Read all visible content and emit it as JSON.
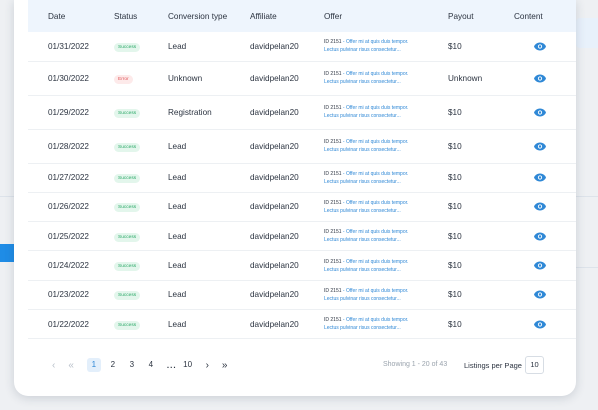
{
  "columns": [
    "Date",
    "Status",
    "Conversion type",
    "Affiliate",
    "Offer",
    "Payout",
    "Content"
  ],
  "rows": [
    {
      "date": "01/31/2022",
      "status": "Success",
      "status_kind": "success",
      "conversion": "Lead",
      "affiliate": "davidpelan20",
      "offer_id": "ID 2151",
      "offer_text": "- Offer mi at quis duis tempor.",
      "offer_line2": "Lectus pulvinar risus consectetur...",
      "payout": "$10"
    },
    {
      "date": "01/30/2022",
      "status": "Error",
      "status_kind": "error",
      "conversion": "Unknown",
      "affiliate": "davidpelan20",
      "offer_id": "ID 2151",
      "offer_text": "- Offer mi at quis duis tempor.",
      "offer_line2": "Lectus pulvinar risus consectetur...",
      "payout": "Unknown"
    },
    {
      "date": "01/29/2022",
      "status": "Success",
      "status_kind": "success",
      "conversion": "Registration",
      "affiliate": "davidpelan20",
      "offer_id": "ID 2151",
      "offer_text": "- Offer mi at quis duis tempor.",
      "offer_line2": "Lectus pulvinar risus consectetur...",
      "payout": "$10"
    },
    {
      "date": "01/28/2022",
      "status": "Success",
      "status_kind": "success",
      "conversion": "Lead",
      "affiliate": "davidpelan20",
      "offer_id": "ID 2151",
      "offer_text": "- Offer mi at quis duis tempor.",
      "offer_line2": "Lectus pulvinar risus consectetur...",
      "payout": "$10"
    },
    {
      "date": "01/27/2022",
      "status": "Success",
      "status_kind": "success",
      "conversion": "Lead",
      "affiliate": "davidpelan20",
      "offer_id": "ID 2151",
      "offer_text": "- Offer mi at quis duis tempor.",
      "offer_line2": "Lectus pulvinar risus consectetur...",
      "payout": "$10"
    },
    {
      "date": "01/26/2022",
      "status": "Success",
      "status_kind": "success",
      "conversion": "Lead",
      "affiliate": "davidpelan20",
      "offer_id": "ID 2151",
      "offer_text": "- Offer mi at quis duis tempor.",
      "offer_line2": "Lectus pulvinar risus consectetur...",
      "payout": "$10"
    },
    {
      "date": "01/25/2022",
      "status": "Success",
      "status_kind": "success",
      "conversion": "Lead",
      "affiliate": "davidpelan20",
      "offer_id": "ID 2151",
      "offer_text": "- Offer mi at quis duis tempor.",
      "offer_line2": "Lectus pulvinar risus consectetur...",
      "payout": "$10"
    },
    {
      "date": "01/24/2022",
      "status": "Success",
      "status_kind": "success",
      "conversion": "Lead",
      "affiliate": "davidpelan20",
      "offer_id": "ID 2151",
      "offer_text": "- Offer mi at quis duis tempor.",
      "offer_line2": "Lectus pulvinar risus consectetur...",
      "payout": "$10"
    },
    {
      "date": "01/23/2022",
      "status": "Success",
      "status_kind": "success",
      "conversion": "Lead",
      "affiliate": "davidpelan20",
      "offer_id": "ID 2151",
      "offer_text": "- Offer mi at quis duis tempor.",
      "offer_line2": "Lectus pulvinar risus consectetur...",
      "payout": "$10"
    },
    {
      "date": "01/22/2022",
      "status": "Success",
      "status_kind": "success",
      "conversion": "Lead",
      "affiliate": "davidpelan20",
      "offer_id": "ID 2151",
      "offer_text": "- Offer mi at quis duis tempor.",
      "offer_line2": "Lectus pulvinar risus consectetur...",
      "payout": "$10"
    }
  ],
  "content_icon": "eye-icon",
  "colors": {
    "accent": "#2f88d6",
    "success": "#28a765",
    "error": "#e0565a",
    "header_bg": "#eef5fd"
  },
  "pagination": {
    "prev": "‹",
    "first": "«",
    "pages": [
      "1",
      "2",
      "3",
      "4"
    ],
    "active_page": "1",
    "ellipsis": "...",
    "last_page": "10",
    "next": "›",
    "last": "»",
    "showing": "Showing 1 - 20 of 43",
    "listings_label": "Listings per Page",
    "per_page": "10"
  }
}
